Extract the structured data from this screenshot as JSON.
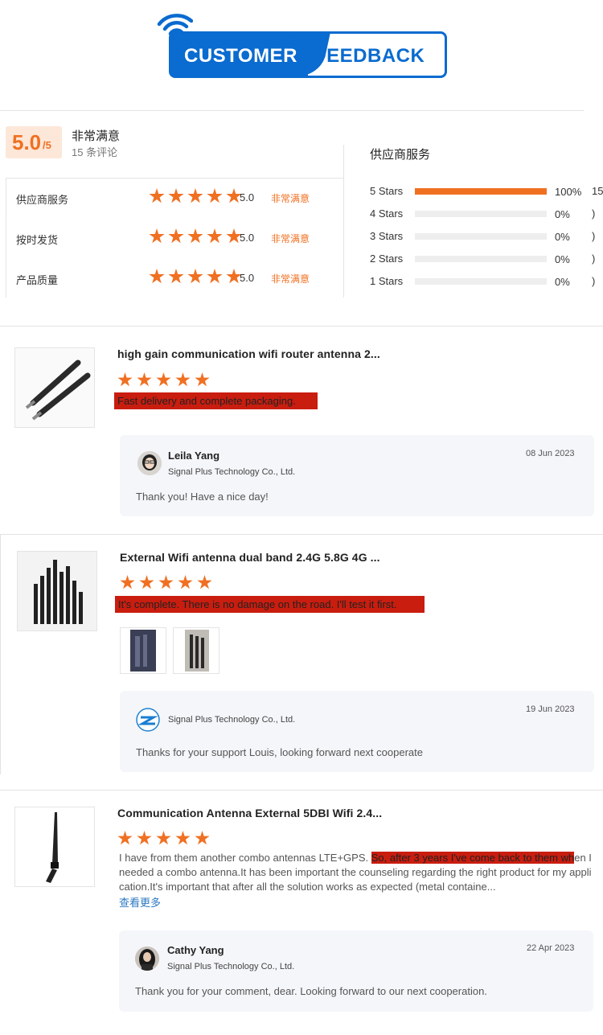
{
  "header": {
    "logo_left": "CUSTOMER",
    "logo_right": "FEEDBACK"
  },
  "summary": {
    "score": "5.0",
    "score_suffix": "/5",
    "satisfaction": "非常满意",
    "review_count": "15 条评论",
    "rows": [
      {
        "label": "供应商服务",
        "value": "5.0",
        "text": "非常满意",
        "stars": 5
      },
      {
        "label": "按时发货",
        "value": "5.0",
        "text": "非常满意",
        "stars": 5
      },
      {
        "label": "产品质量",
        "value": "5.0",
        "text": "非常满意",
        "stars": 5
      }
    ]
  },
  "service": {
    "title": "供应商服务",
    "distribution": [
      {
        "label": "5  Stars",
        "pct": "100%",
        "fraction": 1.0,
        "count": "15"
      },
      {
        "label": "4  Stars",
        "pct": "0%",
        "fraction": 0,
        "count": ")"
      },
      {
        "label": "3  Stars",
        "pct": "0%",
        "fraction": 0,
        "count": ")"
      },
      {
        "label": "2  Stars",
        "pct": "0%",
        "fraction": 0,
        "count": ")"
      },
      {
        "label": "1  Stars",
        "pct": "0%",
        "fraction": 0,
        "count": ")"
      }
    ]
  },
  "reviews": [
    {
      "product": "high gain communication wifi router antenna 2...",
      "stars": 5,
      "comment": "Fast delivery and complete packaging.",
      "reply": {
        "name": "Leila Yang",
        "company": "Signal Plus Technology Co., Ltd.",
        "date": "08 Jun 2023",
        "message": "Thank you! Have a nice day!"
      }
    },
    {
      "product": "External Wifi antenna dual band 2.4G 5.8G 4G ...",
      "stars": 5,
      "comment": "It's complete. There is no damage on the road. I'll test it first.",
      "reply": {
        "name": "",
        "company": "Signal Plus Technology Co., Ltd.",
        "date": "19 Jun 2023",
        "message": "Thanks for your support Louis, looking forward next cooperate"
      }
    },
    {
      "product": "Communication Antenna External 5DBI Wifi 2.4...",
      "stars": 5,
      "comment_part1": "I have from them another combo antennas LTE+GPS. ",
      "comment_part2": "So, after 3 years I've come back to them wh",
      "comment_part3": "en I needed a combo antenna.It has been important the counseling regarding the right product for my application.It's important that after all the solution works as expected (metal containe...",
      "see_more": "查看更多",
      "reply": {
        "name": "Cathy Yang",
        "company": "Signal Plus Technology Co., Ltd.",
        "date": "22 Apr 2023",
        "message": "Thank you for your comment, dear. Looking forward to our next cooperation."
      }
    }
  ]
}
